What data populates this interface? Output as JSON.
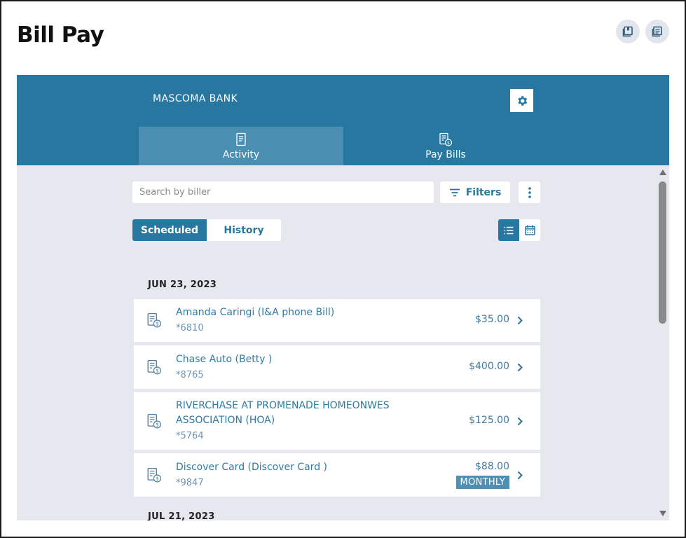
{
  "page": {
    "title": "Bill Pay"
  },
  "header": {
    "bank_name": "MASCOMA BANK"
  },
  "icons": {
    "top_right": [
      "bookmark-add-icon",
      "document-list-icon"
    ],
    "settings": "gear-icon",
    "bill": "bill-dollar-icon",
    "chevron": "chevron-right-icon"
  },
  "tabs": [
    {
      "label": "Activity",
      "active": true,
      "icon": "receipt-icon"
    },
    {
      "label": "Pay Bills",
      "active": false,
      "icon": "bill-dollar-icon"
    }
  ],
  "search": {
    "placeholder": "Search by biller",
    "value": ""
  },
  "toolbar": {
    "filters_label": "Filters"
  },
  "segments": {
    "scheduled_label": "Scheduled",
    "history_label": "History",
    "selected": "Scheduled"
  },
  "view": {
    "selected": "list"
  },
  "groups": [
    {
      "date": "JUN 23, 2023",
      "payments": [
        {
          "name": "Amanda Caringi (I&A phone Bill)",
          "account": "*6810",
          "amount": "$35.00"
        },
        {
          "name": "Chase Auto (Betty )",
          "account": "*8765",
          "amount": "$400.00"
        },
        {
          "name": "RIVERCHASE AT PROMENADE HOMEONWES ASSOCIATION (HOA)",
          "account": "*5764",
          "amount": "$125.00"
        },
        {
          "name": "Discover Card (Discover Card )",
          "account": "*9847",
          "amount": "$88.00",
          "badge": "MONTHLY"
        }
      ]
    },
    {
      "date": "JUL 21, 2023",
      "payments": []
    }
  ],
  "colors": {
    "brand": "#2777a0",
    "tab_active": "#4a8fb2",
    "background": "#e7e7ef",
    "badge": "#4f8fb4"
  }
}
